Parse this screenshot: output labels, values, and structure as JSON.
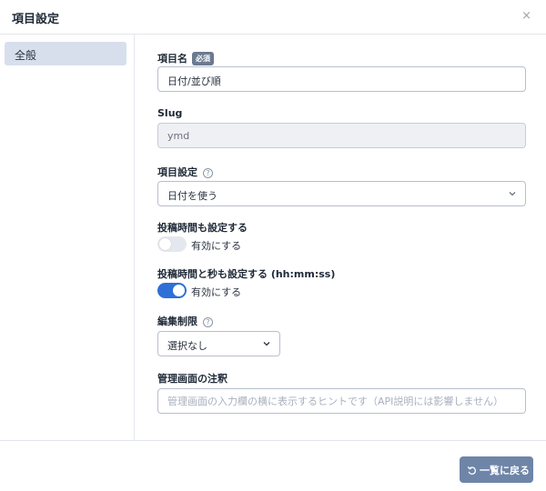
{
  "modal": {
    "title": "項目設定",
    "close_glyph": "×"
  },
  "sidebar": {
    "items": [
      {
        "label": "全般",
        "active": true
      }
    ]
  },
  "form": {
    "name": {
      "label": "項目名",
      "required_badge": "必須",
      "value": "日付/並び順"
    },
    "slug": {
      "label": "Slug",
      "value": "ymd"
    },
    "item_setting": {
      "label": "項目設定",
      "selected": "日付を使う"
    },
    "post_time": {
      "label": "投稿時間も設定する",
      "toggle_label": "有効にする",
      "enabled": false
    },
    "post_time_seconds": {
      "label": "投稿時間と秒も設定する (hh:mm:ss)",
      "toggle_label": "有効にする",
      "enabled": true
    },
    "edit_restriction": {
      "label": "編集制限",
      "selected": "選択なし"
    },
    "admin_note": {
      "label": "管理画面の注釈",
      "placeholder": "管理画面の入力欄の横に表示するヒントです（API説明には影響しません）",
      "value": ""
    }
  },
  "footer": {
    "back_button": "一覧に戻る"
  },
  "colors": {
    "accent": "#2e6fd8",
    "button": "#6e85a8",
    "sidebar_active": "#d7dfec"
  }
}
